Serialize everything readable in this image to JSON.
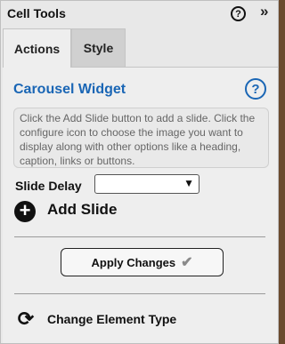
{
  "panel": {
    "title": "Cell Tools",
    "help_icon": "question-circle-icon",
    "collapse_icon": "double-chevron-right-icon",
    "help_glyph": "?",
    "collapse_glyph": "»"
  },
  "tabs": [
    {
      "label": "Actions",
      "active": true
    },
    {
      "label": "Style",
      "active": false
    }
  ],
  "widget": {
    "title": "Carousel Widget",
    "help_glyph": "?",
    "description": "Click the Add Slide button to add a slide. Click the configure icon to choose the image you want to display along with other options like a heading, caption, links or buttons."
  },
  "slide_delay": {
    "label": "Slide Delay",
    "value": ""
  },
  "add_slide": {
    "label": "Add Slide",
    "icon": "plus-circle-icon",
    "glyph": "+"
  },
  "apply": {
    "label": "Apply Changes",
    "icon": "checkmark-icon",
    "glyph": "✔"
  },
  "change_type": {
    "label": "Change Element Type",
    "icon": "refresh-arrows-icon",
    "glyph": "⟳"
  },
  "colors": {
    "accent_blue": "#1a66b5",
    "panel_bg": "#eeeeee",
    "inactive_tab": "#d0d0d0"
  }
}
